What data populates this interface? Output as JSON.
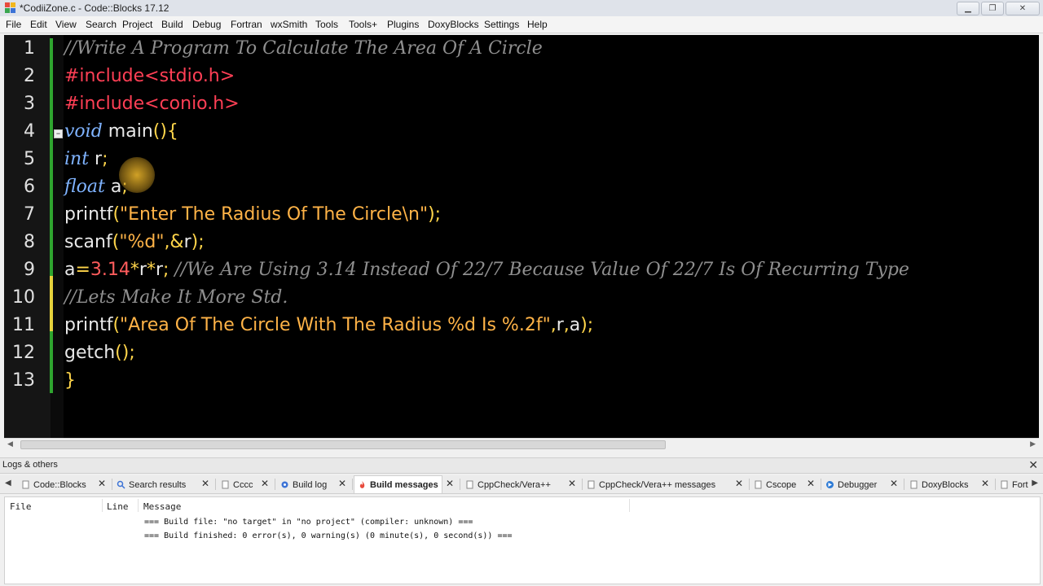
{
  "window": {
    "title": "*CodiiZone.c - Code::Blocks 17.12",
    "controls": [
      "minimize",
      "maximize",
      "close"
    ]
  },
  "menubar": [
    "File",
    "Edit",
    "View",
    "Search",
    "Project",
    "Build",
    "Debug",
    "Fortran",
    "wxSmith",
    "Tools",
    "Tools+",
    "Plugins",
    "DoxyBlocks",
    "Settings",
    "Help"
  ],
  "editor": {
    "line_numbers": [
      "1",
      "2",
      "3",
      "4",
      "5",
      "6",
      "7",
      "8",
      "9",
      "10",
      "11",
      "12",
      "13"
    ],
    "lines": [
      [
        {
          "t": "//Write A Program To Calculate The Area Of A Circle",
          "c": "cm"
        }
      ],
      [
        {
          "t": "#include<stdio.h>",
          "c": "pp"
        }
      ],
      [
        {
          "t": "#include<conio.h>",
          "c": "pp"
        }
      ],
      [
        {
          "t": "void",
          "c": "kw"
        },
        {
          "t": " main",
          "c": ""
        },
        {
          "t": "(){",
          "c": "op"
        }
      ],
      [
        {
          "t": "int",
          "c": "kw"
        },
        {
          "t": " r",
          "c": ""
        },
        {
          "t": ";",
          "c": "op"
        }
      ],
      [
        {
          "t": "float",
          "c": "kw"
        },
        {
          "t": " a",
          "c": ""
        },
        {
          "t": ";",
          "c": "op"
        }
      ],
      [
        {
          "t": "printf",
          "c": ""
        },
        {
          "t": "(",
          "c": "op"
        },
        {
          "t": "\"Enter The Radius Of The Circle\\n\"",
          "c": "st"
        },
        {
          "t": ");",
          "c": "op"
        }
      ],
      [
        {
          "t": "scanf",
          "c": ""
        },
        {
          "t": "(",
          "c": "op"
        },
        {
          "t": "\"%d\"",
          "c": "st"
        },
        {
          "t": ",&",
          "c": "op"
        },
        {
          "t": "r",
          "c": ""
        },
        {
          "t": ");",
          "c": "op"
        }
      ],
      [
        {
          "t": "a",
          "c": ""
        },
        {
          "t": "=",
          "c": "op"
        },
        {
          "t": "3.14",
          "c": "nm"
        },
        {
          "t": "*",
          "c": "op"
        },
        {
          "t": "r",
          "c": ""
        },
        {
          "t": "*",
          "c": "op"
        },
        {
          "t": "r",
          "c": ""
        },
        {
          "t": ";",
          "c": "op"
        },
        {
          "t": " //We Are Using 3.14 Instead Of 22/7 Because Value Of 22/7 Is Of Recurring Type",
          "c": "cm"
        }
      ],
      [
        {
          "t": "//Lets Make It More Std.",
          "c": "cm"
        }
      ],
      [
        {
          "t": "printf",
          "c": ""
        },
        {
          "t": "(",
          "c": "op"
        },
        {
          "t": "\"Area Of The Circle With The Radius %d Is %.2f\"",
          "c": "st"
        },
        {
          "t": ",",
          "c": "op"
        },
        {
          "t": "r",
          "c": ""
        },
        {
          "t": ",",
          "c": "op"
        },
        {
          "t": "a",
          "c": ""
        },
        {
          "t": ");",
          "c": "op"
        }
      ],
      [
        {
          "t": "getch",
          "c": ""
        },
        {
          "t": "();",
          "c": "op"
        }
      ],
      [
        {
          "t": "}",
          "c": "op"
        }
      ]
    ],
    "fold_marker": "−"
  },
  "logs_panel": {
    "title": "Logs & others",
    "tabs": [
      "Code::Blocks",
      "Search results",
      "Cccc",
      "Build log",
      "Build messages",
      "CppCheck/Vera++",
      "CppCheck/Vera++ messages",
      "Cscope",
      "Debugger",
      "DoxyBlocks",
      "Fort"
    ],
    "active_tab": "Build messages",
    "columns": [
      "File",
      "Line",
      "Message"
    ],
    "messages": [
      "=== Build file: \"no target\" in \"no project\" (compiler: unknown) ===",
      "=== Build finished: 0 error(s), 0 warning(s) (0 minute(s), 0 second(s)) ==="
    ]
  },
  "icons": {
    "app": "codeblocks-icon",
    "tab_codeblocks": "codeblocks-icon",
    "tab_search": "search-icon",
    "tab_cccc": "document-icon",
    "tab_buildlog": "gear-icon",
    "tab_buildmessages": "flame-icon",
    "tab_cppcheck": "document-icon",
    "tab_cscope": "document-icon",
    "tab_debugger": "debugger-icon",
    "tab_doxyblocks": "document-icon"
  }
}
